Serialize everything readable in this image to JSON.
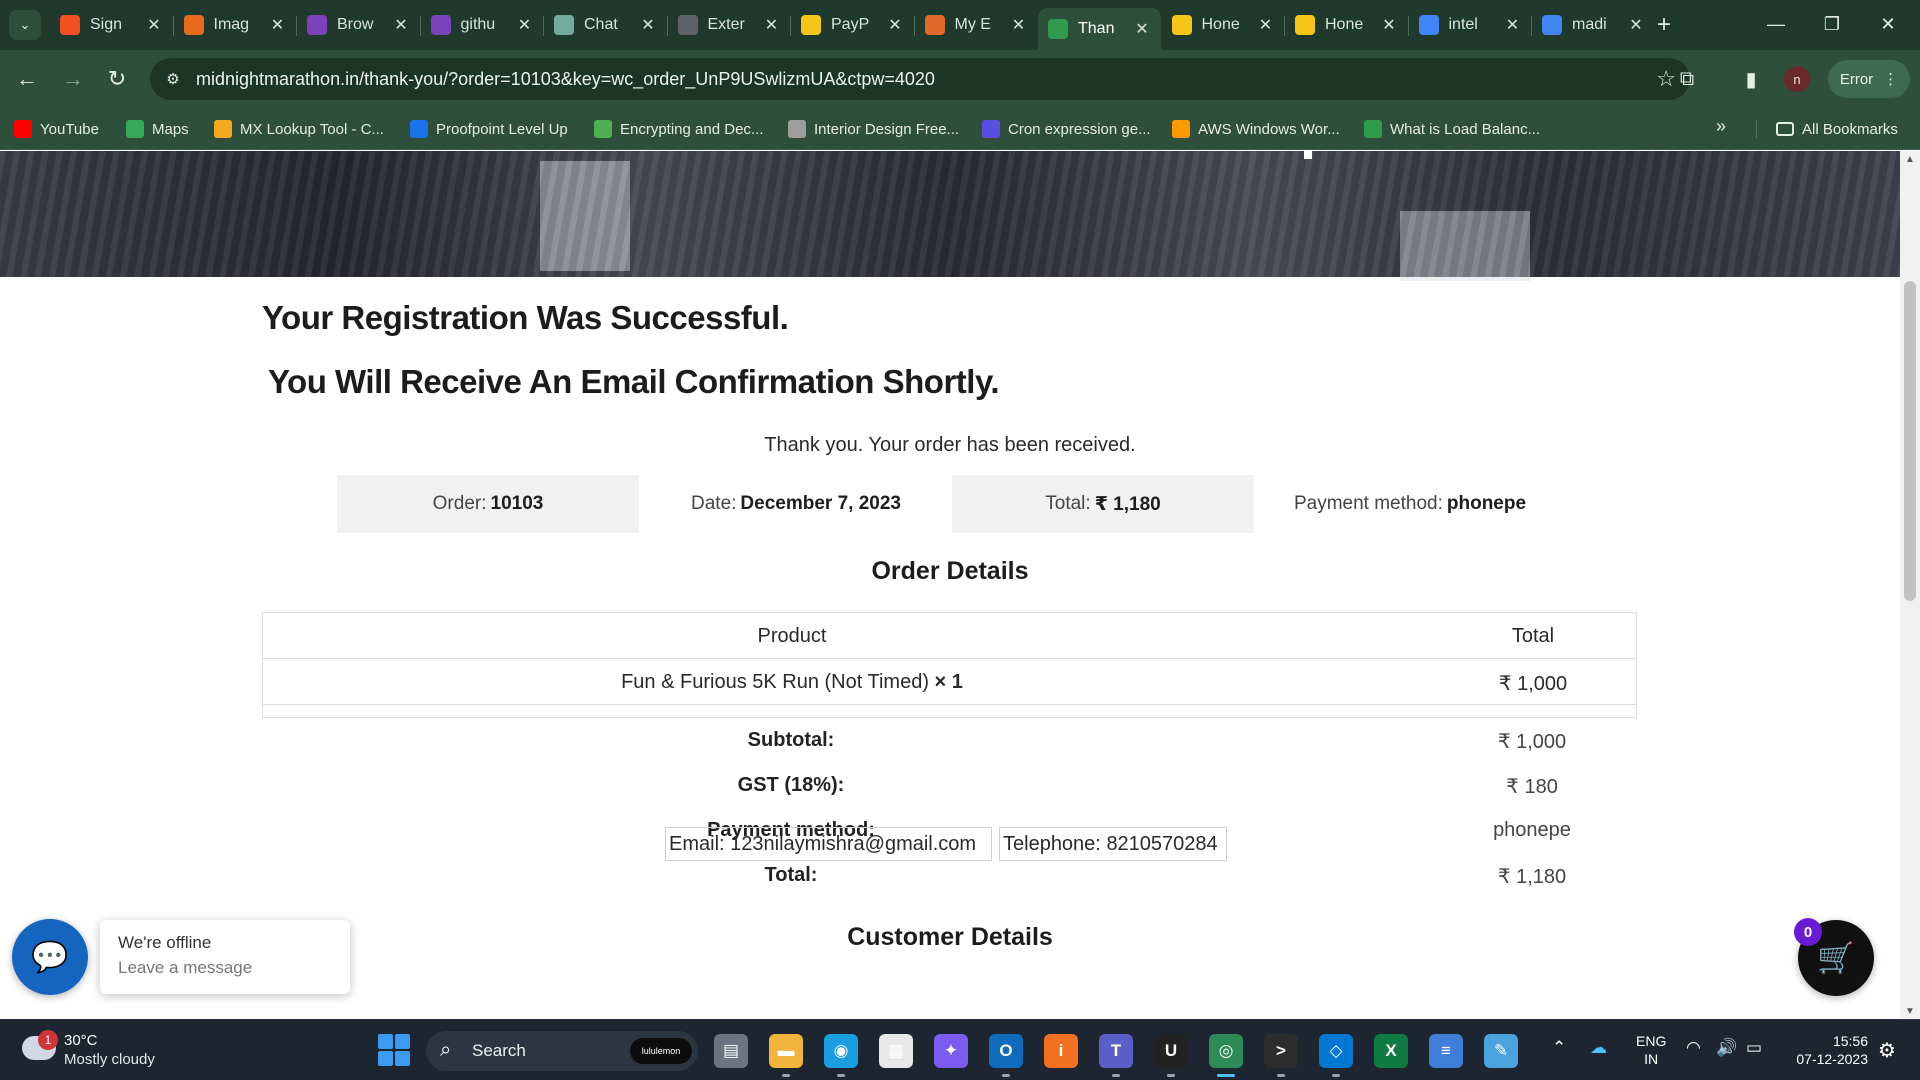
{
  "browser": {
    "tabs": [
      {
        "title": "Sign",
        "icon": "microsoft-icon",
        "color": "#f25022"
      },
      {
        "title": "Imag",
        "icon": "image-tool-icon",
        "color": "#e86a1f"
      },
      {
        "title": "Brow",
        "icon": "terraform-icon",
        "color": "#7b42bc"
      },
      {
        "title": "githu",
        "icon": "terraform-icon",
        "color": "#7b42bc"
      },
      {
        "title": "Chat",
        "icon": "chatgpt-icon",
        "color": "#74aa9c"
      },
      {
        "title": "Exter",
        "icon": "puzzle-icon",
        "color": "#5f6368"
      },
      {
        "title": "PayP",
        "icon": "rainbow-icon",
        "color": "#f5c518"
      },
      {
        "title": "My E",
        "icon": "cursive-icon",
        "color": "#e06a2a"
      },
      {
        "title": "Than",
        "icon": "check-icon",
        "color": "#2e9b4d"
      },
      {
        "title": "Hone",
        "icon": "rainbow-icon",
        "color": "#f5c518"
      },
      {
        "title": "Hone",
        "icon": "rainbow-icon",
        "color": "#f5c518"
      },
      {
        "title": "intel",
        "icon": "google-icon",
        "color": "#4285f4"
      },
      {
        "title": "madi",
        "icon": "google-icon",
        "color": "#4285f4"
      }
    ],
    "active_tab_index": 8,
    "url": "midnightmarathon.in/thank-you/?order=10103&key=wc_order_UnP9USwlizmUA&ctpw=4020",
    "profile_initial": "n",
    "error_label": "Error",
    "bookmarks": [
      {
        "label": "YouTube",
        "icon": "youtube-icon",
        "color": "#ff0000"
      },
      {
        "label": "Maps",
        "icon": "maps-icon",
        "color": "#34a853"
      },
      {
        "label": "MX Lookup Tool - C...",
        "icon": "mxtoolbox-icon",
        "color": "#f4a81d"
      },
      {
        "label": "Proofpoint Level Up",
        "icon": "proofpoint-icon",
        "color": "#1a73e8"
      },
      {
        "label": "Encrypting and Dec...",
        "icon": "leaf-icon",
        "color": "#4caf50"
      },
      {
        "label": "Interior Design Free...",
        "icon": "image-icon",
        "color": "#9e9e9e"
      },
      {
        "label": "Cron expression ge...",
        "icon": "cron-icon",
        "color": "#5c4ee5"
      },
      {
        "label": "AWS Windows Wor...",
        "icon": "aws-icon",
        "color": "#ff9900"
      },
      {
        "label": "What is Load Balanc...",
        "icon": "shield-icon",
        "color": "#2e9b4d"
      }
    ],
    "all_bookmarks_label": "All Bookmarks",
    "colors": {
      "frame": "#1f3a2c",
      "toolbar": "#2f4f3d"
    }
  },
  "page": {
    "heading_1": "Your Registration Was Successful.",
    "heading_2": "You Will Receive An Email Confirmation Shortly.",
    "thank_you": "Thank you. Your order has been received.",
    "overview": {
      "order_label": "Order:",
      "order_value": "10103",
      "date_label": "Date:",
      "date_value": "December 7, 2023",
      "total_label": "Total:",
      "total_value": "₹ 1,180",
      "payment_label": "Payment method:",
      "payment_value": "phonepe"
    },
    "order_details_title": "Order Details",
    "table": {
      "headers": [
        "Product",
        "Total"
      ],
      "items": [
        {
          "product": "Fun & Furious 5K Run (Not Timed)",
          "qty": "× 1",
          "total": "₹ 1,000"
        }
      ]
    },
    "totals": [
      {
        "label": "Subtotal:",
        "value": "₹ 1,000"
      },
      {
        "label": "GST (18%):",
        "value": "₹ 180"
      },
      {
        "label": "Payment method:",
        "value": "phonepe"
      },
      {
        "label": "Total:",
        "value": "₹ 1,180"
      }
    ],
    "customer_details_title": "Customer Details",
    "customer": {
      "email_label": "Email:",
      "email": "123nilaymishra@gmail.com",
      "telephone_label": "Telephone:",
      "telephone": "8210570284"
    },
    "chat_widget": {
      "status": "We're offline",
      "action": "Leave a message"
    },
    "cart_count": "0"
  },
  "taskbar": {
    "weather_temp": "30°C",
    "weather_desc": "Mostly cloudy",
    "weather_badge": "1",
    "search_label": "Search",
    "search_promo": "lululemon",
    "language": "ENG",
    "region": "IN",
    "time": "15:56",
    "date": "07-12-2023",
    "apps": [
      "file-manager-icon",
      "folder-icon",
      "edge-icon",
      "store-icon",
      "copilot-icon",
      "outlook-icon",
      "avast-icon",
      "teams-icon",
      "uber-icon",
      "chrome-icon",
      "terminal-icon",
      "vscode-icon",
      "excel-icon",
      "notepad-icon",
      "paint-icon"
    ]
  }
}
